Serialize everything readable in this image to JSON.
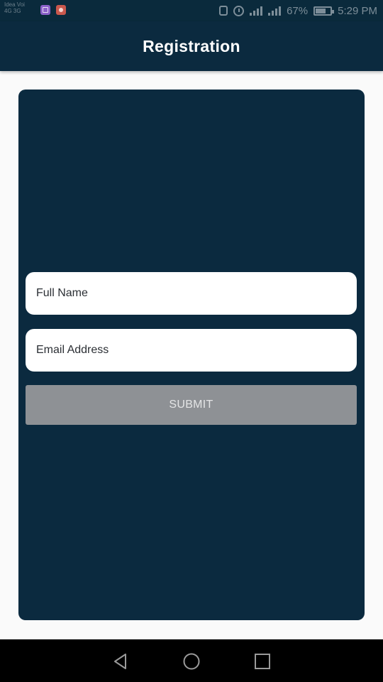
{
  "status_bar": {
    "carrier_line1": "Idea Voi",
    "carrier_line2": "4G 3G",
    "battery_text": "67%",
    "time": "5:29 PM",
    "icons": [
      "app-notification-icon",
      "screen-recorder-icon",
      "vibrate-icon",
      "alarm-icon",
      "signal-icon",
      "signal-icon",
      "battery-icon"
    ]
  },
  "app_bar": {
    "title": "Registration"
  },
  "form": {
    "full_name": {
      "placeholder": "Full Name",
      "value": ""
    },
    "email": {
      "placeholder": "Email Address",
      "value": ""
    },
    "submit_label": "SUBMIT"
  },
  "nav_bar": {
    "icons": [
      "back-icon",
      "home-icon",
      "recent-apps-icon"
    ]
  },
  "colors": {
    "primary": "#0b2a3f",
    "background": "#fafafa",
    "submit_disabled": "#8e9195",
    "field_bg": "#ffffff"
  }
}
